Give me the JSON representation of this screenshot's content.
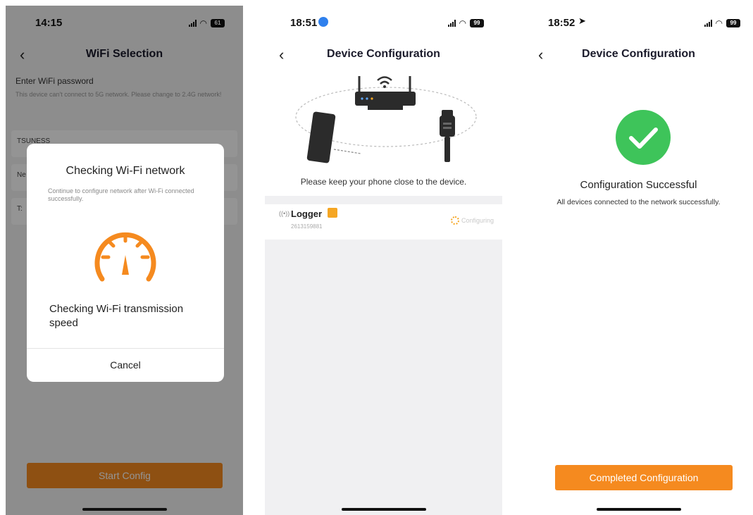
{
  "screens": [
    {
      "status": {
        "time": "14:15",
        "battery": "61"
      },
      "title": "WiFi Selection",
      "password_label": "Enter WiFi password",
      "hint": "This device can't connect to 5G network. Please change to 2.4G network!",
      "fields": [
        "TSUNESS",
        "Ne",
        "T:"
      ],
      "start_button": "Start Config",
      "dialog": {
        "title": "Checking Wi-Fi network",
        "subtitle": "Continue to configure network after Wi-Fi connected successfully.",
        "status": "Checking Wi-Fi transmission speed",
        "cancel": "Cancel",
        "icon": "speedometer-icon",
        "accent_color": "#f58a1f"
      }
    },
    {
      "status": {
        "time": "18:51",
        "battery": "99"
      },
      "title": "Device Configuration",
      "hint": "Please keep your phone close to the device.",
      "device": {
        "name": "Logger",
        "serial": "2613159881",
        "state": "Configuring"
      }
    },
    {
      "status": {
        "time": "18:52",
        "battery": "99"
      },
      "title": "Device Configuration",
      "result_title": "Configuration Successful",
      "result_subtitle": "All devices connected to the network  successfully.",
      "done_button": "Completed Configuration",
      "success_color": "#3ec45a"
    }
  ]
}
